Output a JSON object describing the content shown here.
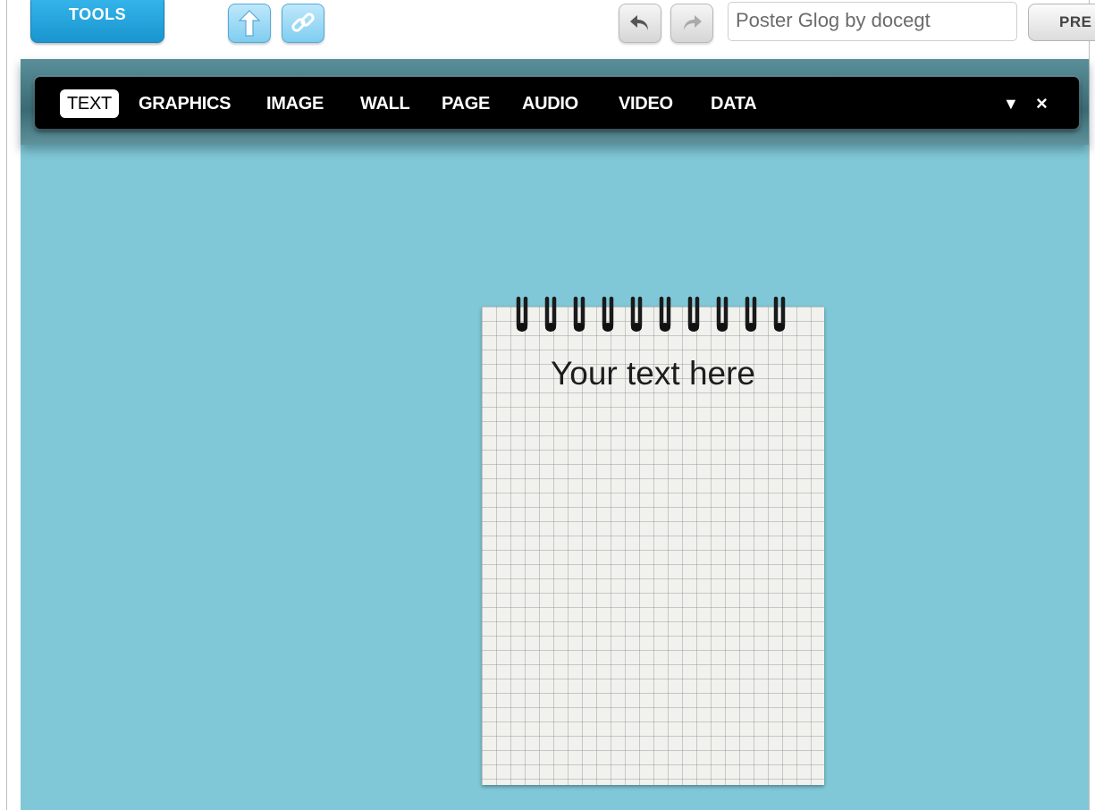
{
  "toolbar": {
    "tools_label": "TOOLS",
    "upload_icon": "arrow-up-icon",
    "link_icon": "link-icon",
    "undo_icon": "undo-icon",
    "redo_icon": "redo-icon",
    "title_value": "Poster Glog by docegt",
    "preview_label": "PRE"
  },
  "menu": {
    "items": [
      {
        "label": "TEXT",
        "active": true
      },
      {
        "label": "GRAPHICS"
      },
      {
        "label": "IMAGE"
      },
      {
        "label": "WALL"
      },
      {
        "label": "PAGE"
      },
      {
        "label": "AUDIO"
      },
      {
        "label": "VIDEO"
      },
      {
        "label": "DATA"
      }
    ],
    "collapse_icon": "▼",
    "close_icon": "×"
  },
  "notepad": {
    "text": "Your text here"
  },
  "colors": {
    "canvas": "#80c8d7",
    "menubar": "#000000",
    "tools_button": "#1fa3dd"
  }
}
